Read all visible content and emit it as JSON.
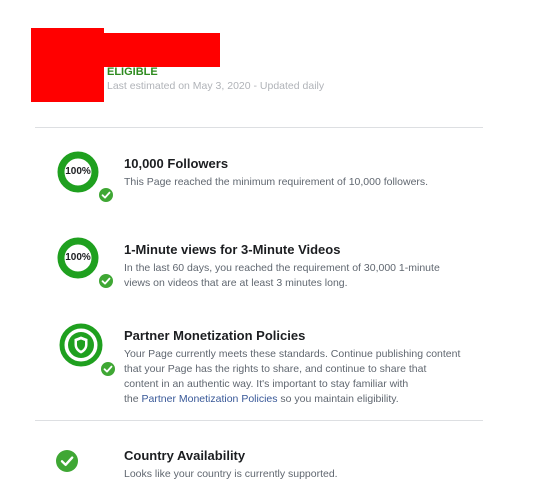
{
  "header": {
    "status": "ELIGIBLE",
    "estimate_note": "Last estimated on May 3, 2020 - Updated daily"
  },
  "requirements": [
    {
      "progress_label": "100%",
      "progress": 1.0,
      "title": "10,000 Followers",
      "description": "This Page reached the minimum requirement of 10,000 followers."
    },
    {
      "progress_label": "100%",
      "progress": 1.0,
      "title": "1-Minute views for 3-Minute Videos",
      "description_lines": [
        "In the last 60 days, you reached the requirement of 30,000 1-minute",
        "views on videos that are at least 3 minutes long."
      ]
    },
    {
      "icon": "shield-icon",
      "title": "Partner Monetization Policies",
      "description_lines": [
        "Your Page currently meets these standards. Continue publishing content",
        "that your Page has the rights to share, and continue to share that",
        "content in an authentic way. It's important to stay familiar with"
      ],
      "last_line_prefix": "the ",
      "link_text": "Partner Monetization Policies",
      "last_line_suffix": " so you maintain eligibility."
    },
    {
      "icon": "check-icon",
      "title": "Country Availability",
      "description": "Looks like your country is currently supported."
    }
  ],
  "colors": {
    "accent_green": "#3fa734",
    "ring_green": "#1fa01f",
    "status_green": "#2e8b1f",
    "redaction": "#ff0000",
    "link": "#385898"
  }
}
